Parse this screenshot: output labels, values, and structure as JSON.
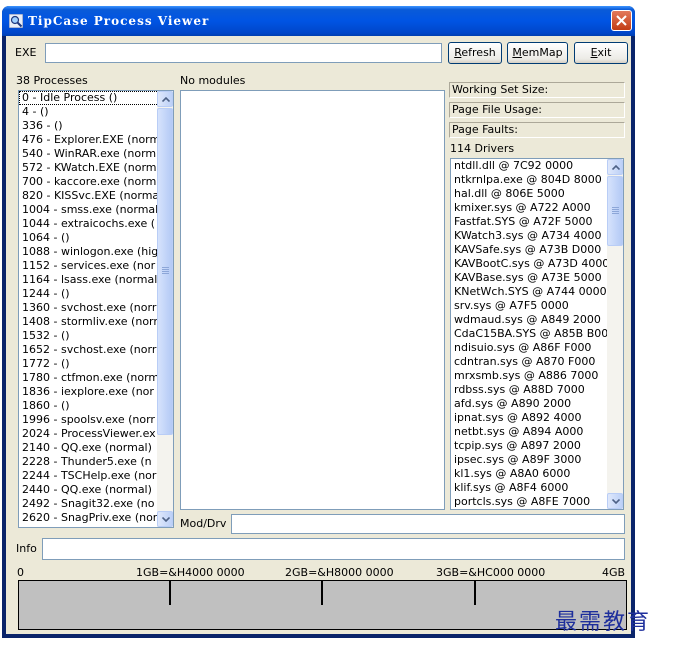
{
  "window": {
    "title": "TipCase Process Viewer"
  },
  "toolbar": {
    "exe_label": "EXE",
    "exe_value": "",
    "refresh_prefix": "",
    "refresh_u": "R",
    "refresh_rest": "efresh",
    "memmap_u": "M",
    "memmap_rest": "emMap",
    "exit_u": "E",
    "exit_prefix": "",
    "exit_rest": "xit"
  },
  "processes": {
    "header": "38 Processes",
    "items": [
      "0 - Idle Process ()",
      "4 -  ()",
      "336 -  ()",
      "476 - Explorer.EXE (norm",
      "540 - WinRAR.exe (norm",
      "572 - KWatch.EXE (norm",
      "700 - kaccore.exe (norm",
      "820 - KISSvc.EXE (norma",
      "1004 - smss.exe (normal",
      "1044 - extraicochs.exe (",
      "1064 -  ()",
      "1088 - winlogon.exe (hig",
      "1152 - services.exe (nor",
      "1164 - lsass.exe (normal)",
      "1244 -  ()",
      "1360 - svchost.exe (norr",
      "1408 - stormliv.exe (norr",
      "1532 -  ()",
      "1652 - svchost.exe (norr",
      "1772 -  ()",
      "1780 - ctfmon.exe (norm",
      "1836 - iexplore.exe (nor",
      "1860 -  ()",
      "1996 - spoolsv.exe (norr",
      "2024 - ProcessViewer.ex",
      "2140 - QQ.exe (normal)",
      "2228 - Thunder5.exe (n",
      "2244 - TSCHelp.exe (nor",
      "2440 - QQ.exe (normal)",
      "2492 - Snagit32.exe (no",
      "2620 - SnagPriv.exe (nor"
    ]
  },
  "modules": {
    "header": "No modules",
    "items": []
  },
  "stats": {
    "working_set": "Working Set Size:",
    "page_file": "Page File Usage:",
    "page_faults": "Page Faults:"
  },
  "drivers": {
    "header": "114 Drivers",
    "items": [
      "ntdll.dll @ 7C92 0000",
      "ntkrnlpa.exe @ 804D 8000",
      "hal.dll @ 806E 5000",
      "kmixer.sys @ A722 A000",
      "Fastfat.SYS @ A72F 5000",
      "KWatch3.sys @ A734 4000",
      "KAVSafe.sys @ A73B D000",
      "KAVBootC.sys @ A73D 4000",
      "KAVBase.sys @ A73E 5000",
      "KNetWch.SYS @ A744 0000",
      "srv.sys @ A7F5 0000",
      "wdmaud.sys @ A849 2000",
      "CdaC15BA.SYS @ A85B B00",
      "ndisuio.sys @ A86F F000",
      "cdntran.sys @ A870 F000",
      "mrxsmb.sys @ A886 7000",
      "rdbss.sys @ A88D 7000",
      "afd.sys @ A890 2000",
      "ipnat.sys @ A892 4000",
      "netbt.sys @ A894 A000",
      "tcpip.sys @ A897 2000",
      "ipsec.sys @ A89F 3000",
      "kl1.sys @ A8A0 6000",
      "klif.sys @ A8F4 6000",
      "portcls.sys @ A8FE 7000"
    ]
  },
  "mod_drv": {
    "label": "Mod/Drv",
    "value": ""
  },
  "info": {
    "label": "Info",
    "value": ""
  },
  "memory_map": {
    "scale": [
      "0",
      "1GB=&H4000 0000",
      "2GB=&H8000 0000",
      "3GB=&HC000 0000",
      "4GB"
    ]
  },
  "watermark": "最需教育"
}
